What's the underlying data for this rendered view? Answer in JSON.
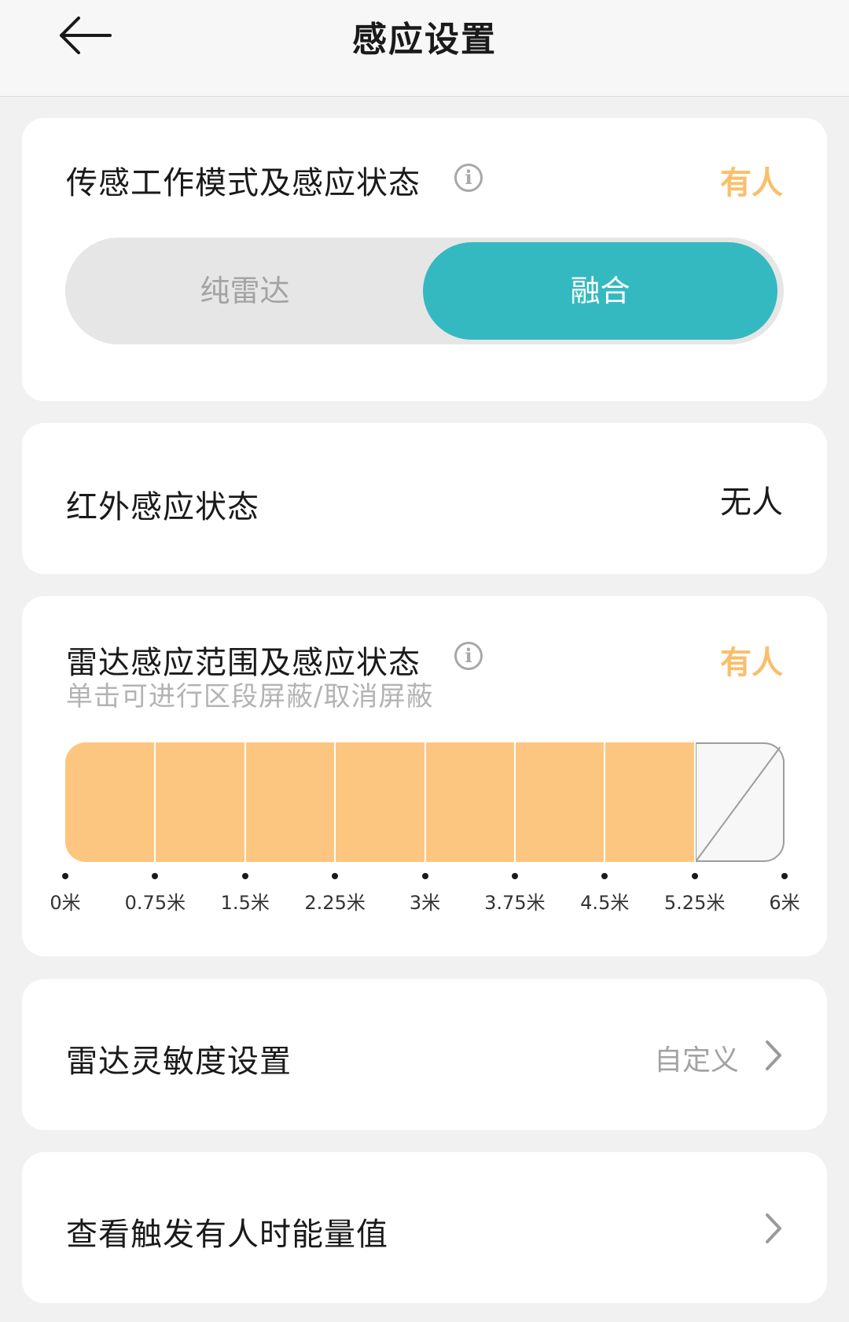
{
  "header": {
    "title": "感应设置"
  },
  "mode_card": {
    "title": "传感工作模式及感应状态",
    "status": "有人",
    "options": [
      "纯雷达",
      "融合"
    ],
    "selected_option": "融合"
  },
  "ir_card": {
    "title": "红外感应状态",
    "status": "无人"
  },
  "radar_card": {
    "title": "雷达感应范围及感应状态",
    "status": "有人",
    "subtitle": "单击可进行区段屏蔽/取消屏蔽",
    "segments_active": [
      true,
      true,
      true,
      true,
      true,
      true,
      true,
      false
    ],
    "ticks": [
      "0米",
      "0.75米",
      "1.5米",
      "2.25米",
      "3米",
      "3.75米",
      "4.5米",
      "5.25米",
      "6米"
    ]
  },
  "sensitivity_row": {
    "label": "雷达灵敏度设置",
    "value": "自定义"
  },
  "energy_row": {
    "label": "查看触发有人时能量值"
  },
  "colors": {
    "accent_teal": "#35b9c0",
    "status_orange": "#f9bf6b",
    "segment_fill": "#fdc680"
  }
}
